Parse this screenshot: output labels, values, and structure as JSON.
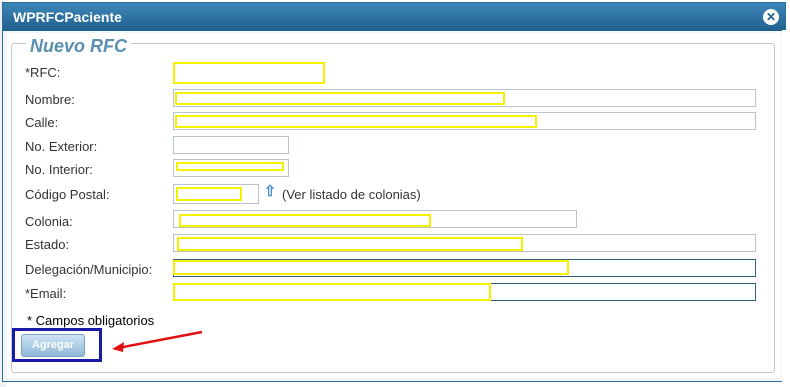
{
  "window": {
    "title": "WPRFCPaciente"
  },
  "form": {
    "legend": "Nuevo RFC",
    "fields": {
      "rfc": "*RFC:",
      "nombre": "Nombre:",
      "calle": "Calle:",
      "no_exterior": "No. Exterior:",
      "no_interior": "No. Interior:",
      "codigo_postal": "Código Postal:",
      "colonia": "Colonia:",
      "estado": "Estado:",
      "delegacion": "Delegación/Municipio:",
      "email": "*Email:"
    },
    "ver_listado": "(Ver listado de colonias)",
    "required_note": "* Campos obligatorios",
    "submit_label": "Agregar"
  },
  "colors": {
    "titlebar": "#2c6e99",
    "highlight": "#f5f200",
    "annotation_box": "#1a1aa8",
    "arrow": "#e01010"
  },
  "icons": [
    "close-icon",
    "up-arrow-icon"
  ]
}
